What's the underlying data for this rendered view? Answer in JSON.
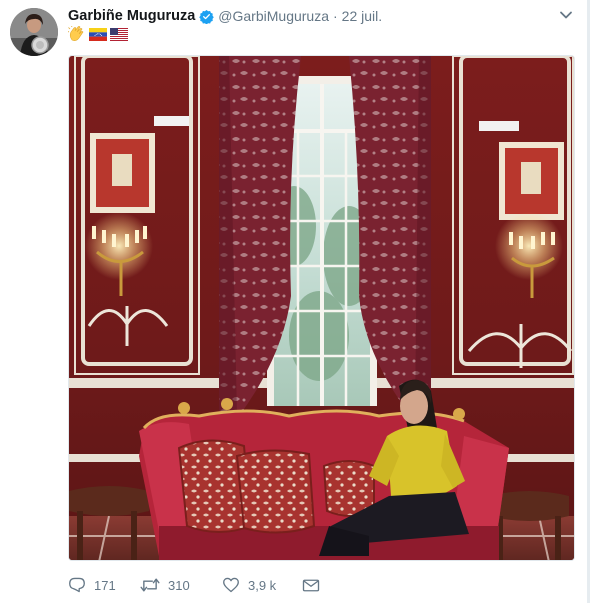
{
  "tweet": {
    "author_name": "Garbiñe Muguruza",
    "handle": "@GarbiMuguruza",
    "separator": "·",
    "date": "22 juil.",
    "emojis": [
      "clapping-hands-emoji",
      "venezuela-flag-emoji",
      "usa-flag-emoji"
    ],
    "verified": true
  },
  "actions": {
    "reply_count": "171",
    "retweet_count": "310",
    "like_count": "3,9 k"
  },
  "colors": {
    "muted": "#657786",
    "verified_blue": "#1da1f2",
    "text": "#14171a"
  }
}
